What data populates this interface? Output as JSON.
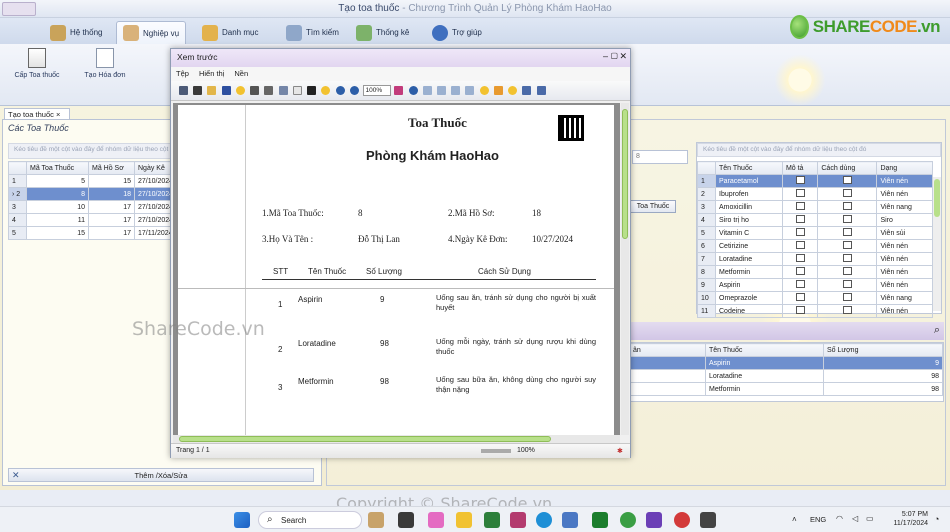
{
  "app": {
    "title": "Tạo toa thuốc",
    "subtitle": " - Chương Trình Quản Lý Phòng Khám HaoHao"
  },
  "ribbon": {
    "tabs": [
      {
        "label": "Hệ thống",
        "icon": "home-icon"
      },
      {
        "label": "Nghiệp vụ",
        "icon": "clipboard-icon"
      },
      {
        "label": "Danh mục",
        "icon": "folder-icon"
      },
      {
        "label": "Tìm kiếm",
        "icon": "search-icon"
      },
      {
        "label": "Thống kê",
        "icon": "chart-icon"
      },
      {
        "label": "Trợ giúp",
        "icon": "help-icon"
      }
    ],
    "buttons": [
      {
        "label": "Cấp Toa thuốc"
      },
      {
        "label": "Tạo Hóa đơn"
      }
    ]
  },
  "logo": {
    "text_a": "SHARE",
    "text_b": "CODE",
    "text_c": ".vn"
  },
  "left": {
    "tab_label": "Tạo toa thuốc",
    "section_title": "Các Toa Thuốc",
    "group_hint": "Kéo tiêu đề một cột vào đây để nhóm dữ liệu theo cột đó",
    "columns": [
      "Mã Toa Thuốc",
      "Mã Hồ Sơ",
      "Ngày Kê"
    ],
    "rows": [
      {
        "n": "1",
        "a": "5",
        "b": "15",
        "c": "27/10/2024"
      },
      {
        "n": "2",
        "a": "8",
        "b": "18",
        "c": "27/10/2024"
      },
      {
        "n": "3",
        "a": "10",
        "b": "17",
        "c": "27/10/2024"
      },
      {
        "n": "4",
        "a": "11",
        "b": "17",
        "c": "27/10/2024"
      },
      {
        "n": "5",
        "a": "15",
        "b": "17",
        "c": "17/11/2024"
      }
    ],
    "footer_button": "Thêm /Xóa/Sửa"
  },
  "right": {
    "group_hint": "Kéo tiêu đề một cột vào đây để nhóm dữ liệu theo cột đó",
    "small_field_value": "8",
    "tab_button": "Toa Thuốc",
    "columns": [
      "Tên Thuốc",
      "Mô tả",
      "Cách dùng",
      "Dạng"
    ],
    "rows": [
      {
        "n": "1",
        "name": "Paracetamol",
        "form": "Viên nén"
      },
      {
        "n": "2",
        "name": "Ibuprofen",
        "form": "Viên nén"
      },
      {
        "n": "3",
        "name": "Amoxicillin",
        "form": "Viên nang"
      },
      {
        "n": "4",
        "name": "Siro trị ho",
        "form": "Siro"
      },
      {
        "n": "5",
        "name": "Vitamin C",
        "form": "Viên sủi"
      },
      {
        "n": "6",
        "name": "Cetirizine",
        "form": "Viên nén"
      },
      {
        "n": "7",
        "name": "Loratadine",
        "form": "Viên nén"
      },
      {
        "n": "8",
        "name": "Metformin",
        "form": "Viên nén"
      },
      {
        "n": "9",
        "name": "Aspirin",
        "form": "Viên nén"
      },
      {
        "n": "10",
        "name": "Omeprazole",
        "form": "Viên nang"
      },
      {
        "n": "11",
        "name": "Codeine",
        "form": "Viên nén"
      }
    ],
    "detail_columns": [
      "ân",
      "Tên Thuốc",
      "Số Lượng"
    ],
    "detail_rows": [
      {
        "name": "Aspirin",
        "qty": "9"
      },
      {
        "name": "Loratadine",
        "qty": "98"
      },
      {
        "name": "Metformin",
        "qty": "98"
      }
    ]
  },
  "preview": {
    "title": "Xem trước",
    "menu": [
      "Tệp",
      "Hiển thị",
      "Nền"
    ],
    "zoom": "100%",
    "status_page": "Trang 1 / 1",
    "status_zoom": "100%",
    "report": {
      "heading": "Toa Thuốc",
      "clinic": "Phòng Khám HaoHao",
      "label_id": "1.Mã Toa Thuốc:",
      "value_id": "8",
      "label_record": "2.Mã Hồ Sơ:",
      "value_record": "18",
      "label_name": "3.Họ Và Tên :",
      "value_name": "Đỗ Thị Lan",
      "label_date": "4.Ngày Kê Đơn:",
      "value_date": "10/27/2024",
      "columns": [
        "STT",
        "Tên Thuốc",
        "Số Lượng",
        "Cách Sử Dụng"
      ],
      "items": [
        {
          "stt": "1",
          "name": "Aspirin",
          "qty": "9",
          "usage": "Uống sau ăn, tránh sử dụng cho người bị xuất huyết"
        },
        {
          "stt": "2",
          "name": "Loratadine",
          "qty": "98",
          "usage": "Uống mỗi ngày, tránh sử dụng rượu khi dùng thuốc"
        },
        {
          "stt": "3",
          "name": "Metformin",
          "qty": "98",
          "usage": "Uống sau bữa ăn, không dùng cho người suy thận nặng"
        }
      ]
    }
  },
  "watermarks": {
    "center": "ShareCode.vn",
    "bottom": "Copyright © ShareCode.vn"
  },
  "taskbar": {
    "search": "Search",
    "lang": "ENG",
    "time": "5:07 PM",
    "date": "11/17/2024"
  }
}
